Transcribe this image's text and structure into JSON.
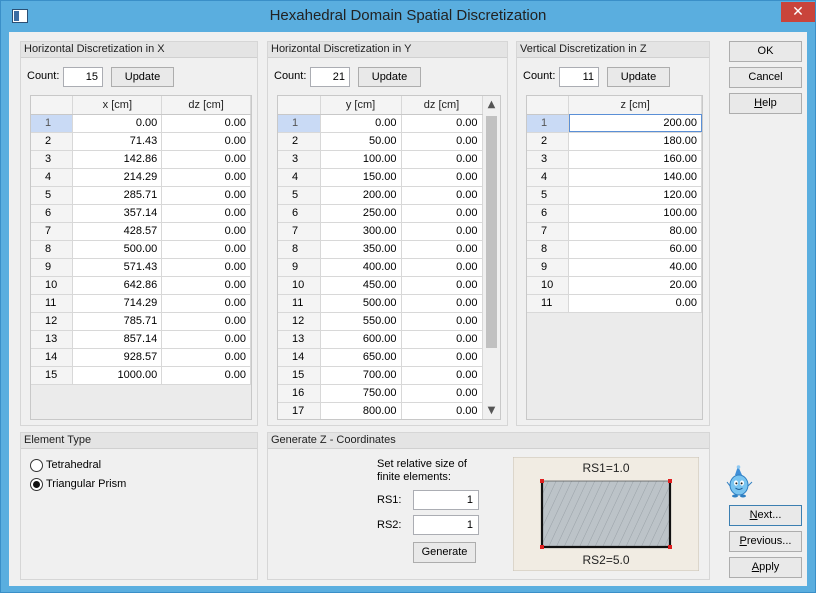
{
  "window": {
    "title": "Hexahedral Domain Spatial Discretization",
    "close_glyph": "✕"
  },
  "horiz_x": {
    "header": "Horizontal Discretization in X",
    "count_label": "Count:",
    "count_value": "15",
    "update_label": "Update",
    "columns": [
      "",
      "x [cm]",
      "dz [cm]"
    ],
    "rows": [
      [
        "1",
        "0.00",
        "0.00"
      ],
      [
        "2",
        "71.43",
        "0.00"
      ],
      [
        "3",
        "142.86",
        "0.00"
      ],
      [
        "4",
        "214.29",
        "0.00"
      ],
      [
        "5",
        "285.71",
        "0.00"
      ],
      [
        "6",
        "357.14",
        "0.00"
      ],
      [
        "7",
        "428.57",
        "0.00"
      ],
      [
        "8",
        "500.00",
        "0.00"
      ],
      [
        "9",
        "571.43",
        "0.00"
      ],
      [
        "10",
        "642.86",
        "0.00"
      ],
      [
        "11",
        "714.29",
        "0.00"
      ],
      [
        "12",
        "785.71",
        "0.00"
      ],
      [
        "13",
        "857.14",
        "0.00"
      ],
      [
        "14",
        "928.57",
        "0.00"
      ],
      [
        "15",
        "1000.00",
        "0.00"
      ]
    ]
  },
  "horiz_y": {
    "header": "Horizontal Discretization in Y",
    "count_label": "Count:",
    "count_value": "21",
    "update_label": "Update",
    "columns": [
      "",
      "y [cm]",
      "dz [cm]"
    ],
    "rows": [
      [
        "1",
        "0.00",
        "0.00"
      ],
      [
        "2",
        "50.00",
        "0.00"
      ],
      [
        "3",
        "100.00",
        "0.00"
      ],
      [
        "4",
        "150.00",
        "0.00"
      ],
      [
        "5",
        "200.00",
        "0.00"
      ],
      [
        "6",
        "250.00",
        "0.00"
      ],
      [
        "7",
        "300.00",
        "0.00"
      ],
      [
        "8",
        "350.00",
        "0.00"
      ],
      [
        "9",
        "400.00",
        "0.00"
      ],
      [
        "10",
        "450.00",
        "0.00"
      ],
      [
        "11",
        "500.00",
        "0.00"
      ],
      [
        "12",
        "550.00",
        "0.00"
      ],
      [
        "13",
        "600.00",
        "0.00"
      ],
      [
        "14",
        "650.00",
        "0.00"
      ],
      [
        "15",
        "700.00",
        "0.00"
      ],
      [
        "16",
        "750.00",
        "0.00"
      ],
      [
        "17",
        "800.00",
        "0.00"
      ]
    ]
  },
  "vert_z": {
    "header": "Vertical Discretization in Z",
    "count_label": "Count:",
    "count_value": "11",
    "update_label": "Update",
    "columns": [
      "",
      "z [cm]"
    ],
    "rows": [
      [
        "1",
        "200.00"
      ],
      [
        "2",
        "180.00"
      ],
      [
        "3",
        "160.00"
      ],
      [
        "4",
        "140.00"
      ],
      [
        "5",
        "120.00"
      ],
      [
        "6",
        "100.00"
      ],
      [
        "7",
        "80.00"
      ],
      [
        "8",
        "60.00"
      ],
      [
        "9",
        "40.00"
      ],
      [
        "10",
        "20.00"
      ],
      [
        "11",
        "0.00"
      ]
    ]
  },
  "element_type": {
    "header": "Element Type",
    "options": [
      "Tetrahedral",
      "Triangular Prism"
    ],
    "selected": "Triangular Prism"
  },
  "generate_z": {
    "header": "Generate Z - Coordinates",
    "instruction_line1": "Set relative size of",
    "instruction_line2": "finite elements:",
    "rs1_label": "RS1:",
    "rs1_value": "1",
    "rs2_label": "RS2:",
    "rs2_value": "1",
    "generate_label": "Generate",
    "preview_top_label": "RS1=1.0",
    "preview_bottom_label": "RS2=5.0"
  },
  "buttons": {
    "ok": "OK",
    "cancel": "Cancel",
    "help_prefix": "H",
    "help_rest": "elp",
    "next_prefix": "N",
    "next_rest": "ext...",
    "previous_prefix": "P",
    "previous_rest": "revious...",
    "apply_prefix": "A",
    "apply_rest": "pply"
  },
  "icons": {
    "app": "window-icon",
    "scroll_up": "▲",
    "scroll_down": "▼",
    "mascot": "water-drop-mascot-icon"
  }
}
